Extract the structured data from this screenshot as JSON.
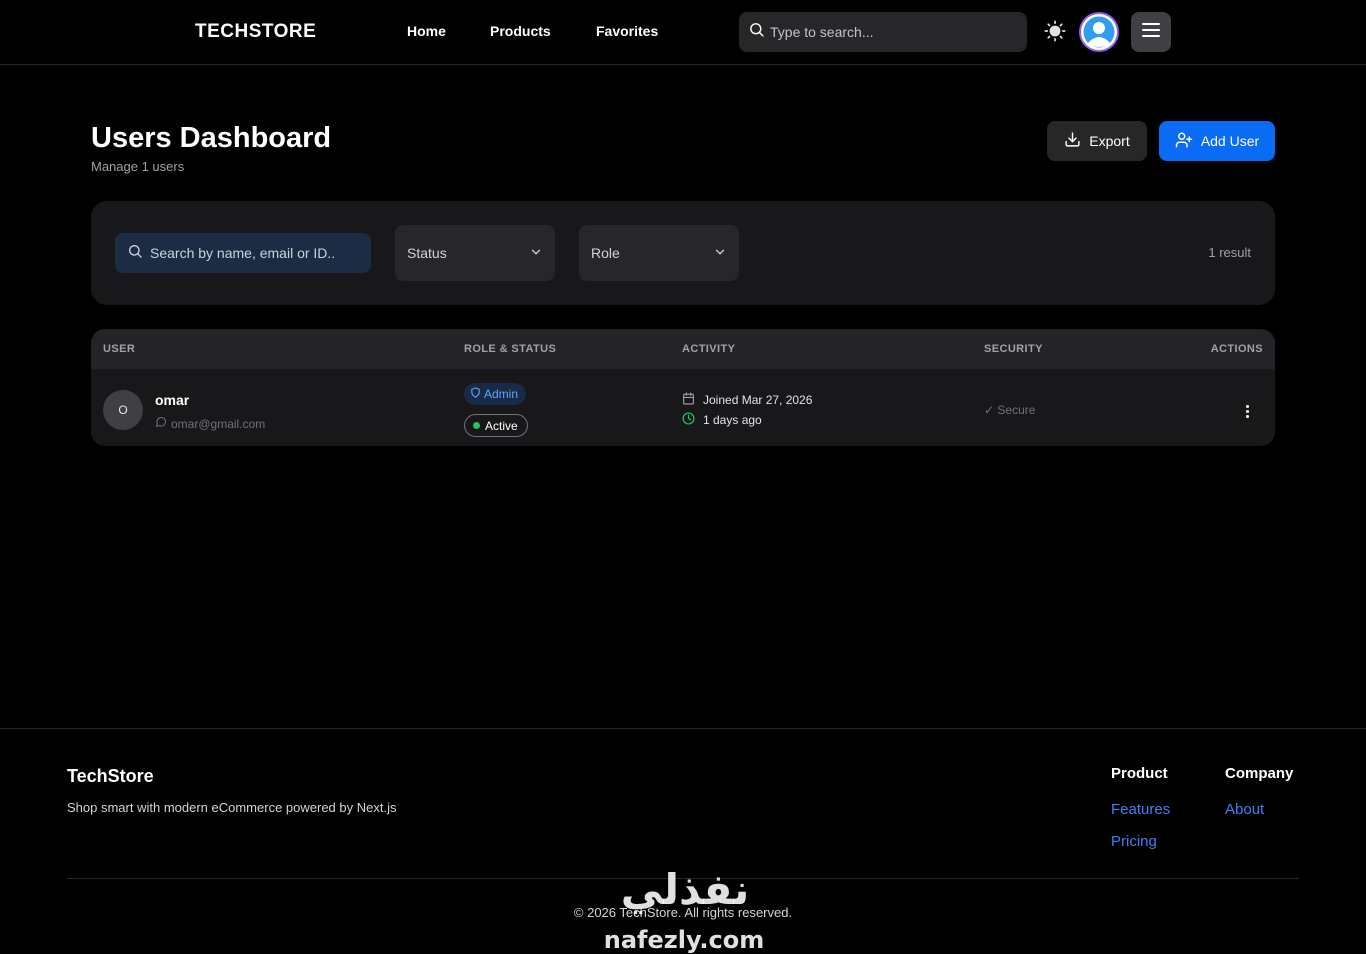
{
  "navbar": {
    "brand": "TECHSTORE",
    "links": [
      "Home",
      "Products",
      "Favorites"
    ],
    "search_placeholder": "Type to search..."
  },
  "header": {
    "title": "Users Dashboard",
    "subtitle": "Manage 1 users",
    "export_label": "Export",
    "add_user_label": "Add User"
  },
  "filters": {
    "search_placeholder": "Search by name, email or ID..",
    "status_label": "Status",
    "role_label": "Role",
    "result_count": "1 result"
  },
  "table": {
    "columns": [
      "USER",
      "ROLE & STATUS",
      "ACTIVITY",
      "SECURITY",
      "ACTIONS"
    ],
    "rows": [
      {
        "avatar_initial": "O",
        "name": "omar",
        "email": "omar@gmail.com",
        "role": "Admin",
        "status": "Active",
        "joined": "Joined Mar 27, 2026",
        "last_active": "1 days ago",
        "security": "✓ Secure"
      }
    ]
  },
  "footer": {
    "brand": "TechStore",
    "tagline": "Shop smart with modern eCommerce powered by Next.js",
    "columns": [
      {
        "title": "Product",
        "links": [
          "Features",
          "Pricing"
        ]
      },
      {
        "title": "Company",
        "links": [
          "About"
        ]
      }
    ],
    "copyright": "© 2026 TechStore. All rights reserved."
  },
  "watermark": {
    "arabic": "نفذلي",
    "latin": "nafezly.com"
  },
  "colors": {
    "background": "#000000",
    "surface": "#18181b",
    "accent": "#0a6cf5",
    "link": "#3b82f6",
    "success": "#22c55e",
    "avatar_ring": "#8b5cf6"
  },
  "icons": {
    "nav_search": "search-icon",
    "theme": "sun-icon",
    "profile": "user-avatar-icon",
    "menu": "hamburger-icon",
    "export": "download-icon",
    "add_user": "user-plus-icon",
    "dropdown": "chevron-down-icon",
    "email": "message-circle-icon",
    "role": "shield-icon",
    "joined": "calendar-icon",
    "last_active": "clock-icon",
    "actions": "more-vertical-icon"
  }
}
